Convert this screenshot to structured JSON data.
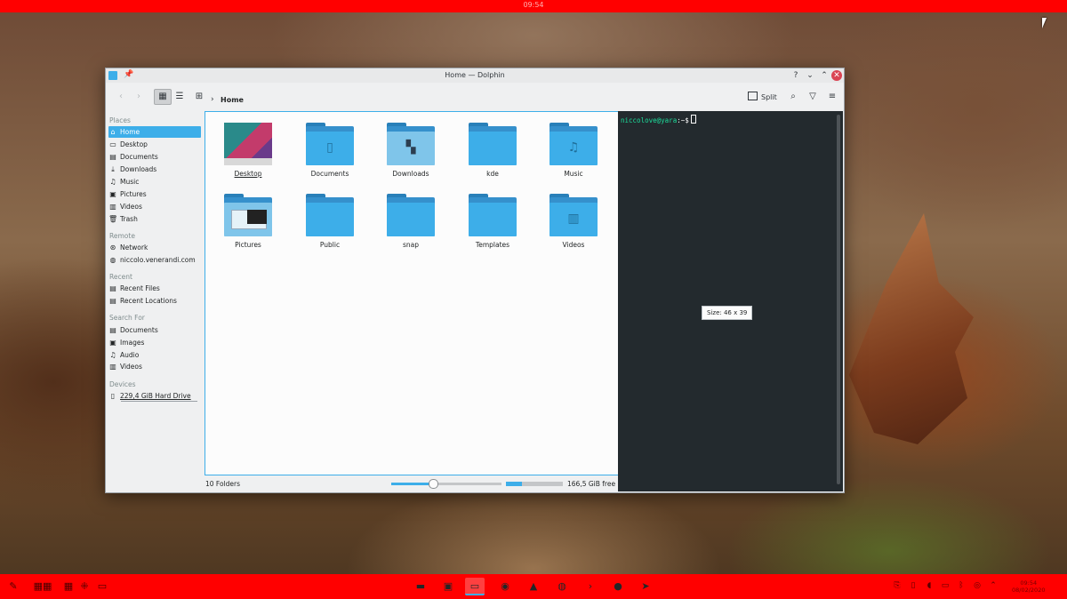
{
  "top_panel": {
    "clock": "09:54"
  },
  "window": {
    "title": "Home — Dolphin",
    "controls": [
      "?",
      "⌄",
      "⌃",
      "✕"
    ]
  },
  "toolbar": {
    "breadcrumb": "Home",
    "split_label": "Split"
  },
  "places": {
    "sections": [
      {
        "header": "Places",
        "items": [
          {
            "icon": "home-icon",
            "label": "Home",
            "selected": true
          },
          {
            "icon": "desktop-icon",
            "label": "Desktop"
          },
          {
            "icon": "documents-icon",
            "label": "Documents"
          },
          {
            "icon": "downloads-icon",
            "label": "Downloads"
          },
          {
            "icon": "music-icon",
            "label": "Music"
          },
          {
            "icon": "pictures-icon",
            "label": "Pictures"
          },
          {
            "icon": "videos-icon",
            "label": "Videos"
          },
          {
            "icon": "trash-icon",
            "label": "Trash"
          }
        ]
      },
      {
        "header": "Remote",
        "items": [
          {
            "icon": "network-icon",
            "label": "Network"
          },
          {
            "icon": "globe-icon",
            "label": "niccolo.venerandi.com"
          }
        ]
      },
      {
        "header": "Recent",
        "items": [
          {
            "icon": "recent-files-icon",
            "label": "Recent Files"
          },
          {
            "icon": "recent-locations-icon",
            "label": "Recent Locations"
          }
        ]
      },
      {
        "header": "Search For",
        "items": [
          {
            "icon": "documents-icon",
            "label": "Documents"
          },
          {
            "icon": "images-icon",
            "label": "Images"
          },
          {
            "icon": "audio-icon",
            "label": "Audio"
          },
          {
            "icon": "videos-icon",
            "label": "Videos"
          }
        ]
      },
      {
        "header": "Devices",
        "items": [
          {
            "icon": "hard-drive-icon",
            "label": "229,4 GiB Hard Drive"
          }
        ]
      }
    ]
  },
  "files": [
    {
      "name": "Desktop",
      "kind": "desktop-thumb"
    },
    {
      "name": "Documents",
      "kind": "folder-documents"
    },
    {
      "name": "Downloads",
      "kind": "folder-downloads"
    },
    {
      "name": "kde",
      "kind": "folder"
    },
    {
      "name": "Music",
      "kind": "folder-music"
    },
    {
      "name": "Pictures",
      "kind": "pictures-thumb"
    },
    {
      "name": "Public",
      "kind": "folder"
    },
    {
      "name": "snap",
      "kind": "folder"
    },
    {
      "name": "Templates",
      "kind": "folder"
    },
    {
      "name": "Videos",
      "kind": "folder-videos"
    }
  ],
  "status": {
    "count": "10 Folders",
    "zoom_level": 0.38,
    "disk_used_fraction": 0.28,
    "free_space": "166,5 GiB free"
  },
  "terminal": {
    "user_host": "niccolove@yara",
    "path_prompt": ":~$",
    "size_tooltip": "Size: 46 x 39"
  },
  "taskbar": {
    "apps": [
      {
        "icon": "dolphin-file-manager-icon",
        "active": false
      },
      {
        "icon": "folder-app-icon",
        "active": false
      },
      {
        "icon": "dolphin-window-icon",
        "active": true
      },
      {
        "icon": "firefox-icon",
        "active": false
      },
      {
        "icon": "inkscape-icon",
        "active": false
      },
      {
        "icon": "web-browser-icon",
        "active": false
      },
      {
        "icon": "konsole-icon",
        "active": false
      },
      {
        "icon": "chrome-icon",
        "active": false
      },
      {
        "icon": "telegram-icon",
        "active": false
      }
    ],
    "clock_time": "09:54",
    "clock_date": "08/02/2020"
  },
  "colors": {
    "accent": "#3daee9",
    "panel": "#ff0000",
    "close": "#da4453",
    "terminal_bg": "#232a2e",
    "terminal_user": "#1cdc9a"
  }
}
